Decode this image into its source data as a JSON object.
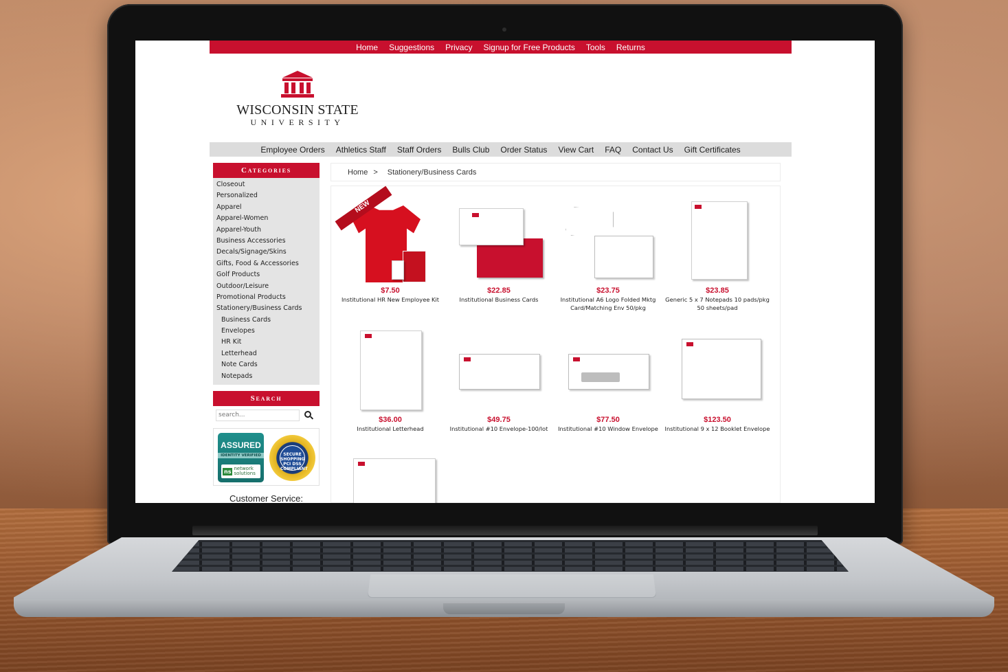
{
  "top_nav": [
    "Home",
    "Suggestions",
    "Privacy",
    "Signup for Free Products",
    "Tools",
    "Returns"
  ],
  "logo": {
    "name": "WISCONSIN STATE",
    "sub": "UNIVERSITY"
  },
  "main_nav": [
    "Employee Orders",
    "Athletics Staff",
    "Staff Orders",
    "Bulls Club",
    "Order Status",
    "View Cart",
    "FAQ",
    "Contact Us",
    "Gift Certificates"
  ],
  "sidebar": {
    "categories_title": "Categories",
    "items": [
      {
        "label": "Closeout",
        "sub": false
      },
      {
        "label": "Personalized",
        "sub": false
      },
      {
        "label": "Apparel",
        "sub": false
      },
      {
        "label": "Apparel-Women",
        "sub": false
      },
      {
        "label": "Apparel-Youth",
        "sub": false
      },
      {
        "label": "Business Accessories",
        "sub": false
      },
      {
        "label": "Decals/Signage/Skins",
        "sub": false
      },
      {
        "label": "Gifts, Food & Accessories",
        "sub": false
      },
      {
        "label": "Golf Products",
        "sub": false
      },
      {
        "label": "Outdoor/Leisure",
        "sub": false
      },
      {
        "label": "Promotional Products",
        "sub": false
      },
      {
        "label": "Stationery/Business Cards",
        "sub": false
      },
      {
        "label": "Business Cards",
        "sub": true
      },
      {
        "label": "Envelopes",
        "sub": true
      },
      {
        "label": "HR Kit",
        "sub": true
      },
      {
        "label": "Letterhead",
        "sub": true
      },
      {
        "label": "Note Cards",
        "sub": true
      },
      {
        "label": "Notepads",
        "sub": true
      }
    ],
    "search_title": "Search",
    "search_placeholder": "search...",
    "badge_assured": "ASSURED",
    "badge_identity": "IDENTITY VERIFIED",
    "badge_ns": "network solutions",
    "badge_pci": "SECURE SHOPPING PCI DSS COMPLIANT",
    "customer_service": "Customer Service:"
  },
  "breadcrumb": {
    "home": "Home",
    "sep": ">",
    "current": "Stationery/Business Cards"
  },
  "products": [
    {
      "price": "$7.50",
      "name": "Institutional HR New Employee Kit",
      "badge": "NEW"
    },
    {
      "price": "$22.85",
      "name": "Institutional Business Cards"
    },
    {
      "price": "$23.75",
      "name": "Institutional A6 Logo Folded Mktg Card/Matching Env 50/pkg"
    },
    {
      "price": "$23.85",
      "name": "Generic 5 x 7 Notepads 10 pads/pkg 50 sheets/pad"
    },
    {
      "price": "$36.00",
      "name": "Institutional Letterhead"
    },
    {
      "price": "$49.75",
      "name": "Institutional #10 Envelope-100/lot"
    },
    {
      "price": "$77.50",
      "name": "Institutional #10 Window Envelope"
    },
    {
      "price": "$123.50",
      "name": "Institutional 9 x 12 Booklet Envelope"
    }
  ],
  "colors": {
    "brand_red": "#c8102e",
    "nav_gray": "#dcdcdc",
    "sidebar_gray": "#e4e4e4"
  }
}
